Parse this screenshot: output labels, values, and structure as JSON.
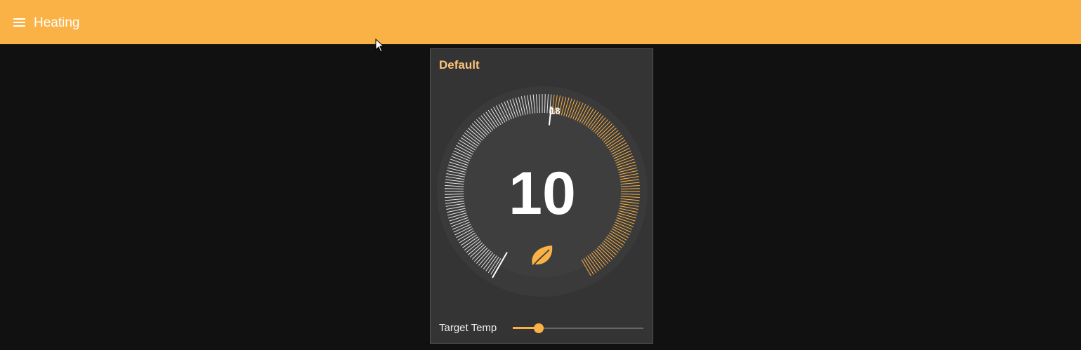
{
  "header": {
    "title": "Heating",
    "menu_icon": "hamburger-menu-icon"
  },
  "card": {
    "title": "Default",
    "gauge": {
      "current_value": "10",
      "target_marker_label": "18",
      "target_value": 18,
      "min": 5,
      "max": 30,
      "icon": "leaf-icon",
      "active_color": "#fab246",
      "inactive_color": "#e6e6e6"
    },
    "slider": {
      "label": "Target Temp",
      "fraction": 0.2
    }
  },
  "colors": {
    "accent": "#fab246",
    "background": "#111111",
    "card": "#343434",
    "title_text": "#fdc27a"
  }
}
